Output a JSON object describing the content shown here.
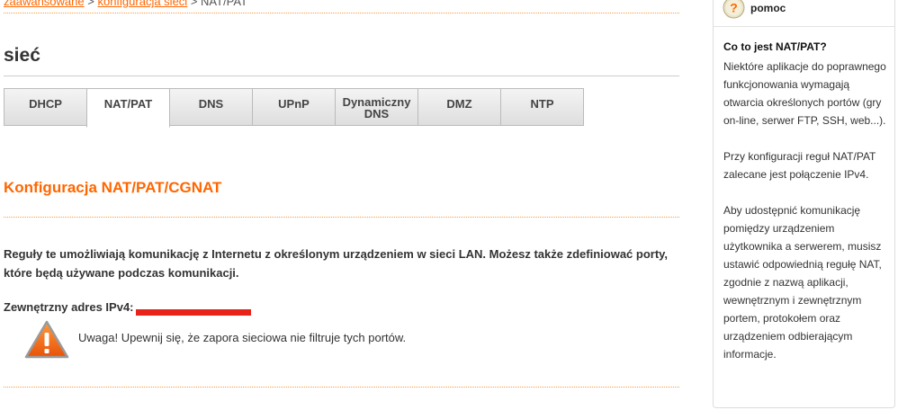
{
  "breadcrumb": {
    "items": [
      "zaawansowane",
      "konfiguracja sieci",
      "NAT/PAT"
    ],
    "separator": ">"
  },
  "page": {
    "title": "sieć"
  },
  "tabs": [
    {
      "label": "DHCP",
      "active": false
    },
    {
      "label": "NAT/PAT",
      "active": true
    },
    {
      "label": "DNS",
      "active": false
    },
    {
      "label": "UPnP",
      "active": false
    },
    {
      "label": "Dynamiczny\nDNS",
      "active": false
    },
    {
      "label": "DMZ",
      "active": false
    },
    {
      "label": "NTP",
      "active": false
    }
  ],
  "section": {
    "title": "Konfiguracja NAT/PAT/CGNAT",
    "description": "Reguły te umożliwiają komunikację z Internetu z określonym urządzeniem w sieci LAN. Możesz także zdefiniować porty, które będą używane podczas komunikacji.",
    "ipv4_label": "Zewnętrzny adres IPv4:",
    "warning_text": "Uwaga! Upewnij się, że zapora sieciowa nie filtruje tych portów."
  },
  "help": {
    "label": "pomoc",
    "title": "Co to jest NAT/PAT?",
    "paragraphs": [
      "Niektóre aplikacje do poprawnego funkcjonowania wymagają otwarcia określonych portów (gry on-line, serwer FTP, SSH, web...).",
      "Przy konfiguracji reguł NAT/PAT zalecane jest połączenie IPv4.",
      "Aby udostępnić komunikację pomiędzy urządzeniem użytkownika a serwerem, musisz ustawić odpowiednią regułę NAT, zgodnie z nazwą aplikacji, wewnętrznym i zewnętrznym portem, protokołem oraz urządzeniem odbierającym informacje."
    ]
  },
  "colors": {
    "accent": "#ff6600",
    "redaction": "#e8241a"
  },
  "icons": {
    "warning": "warning-triangle-icon",
    "help": "question-mark-icon"
  }
}
